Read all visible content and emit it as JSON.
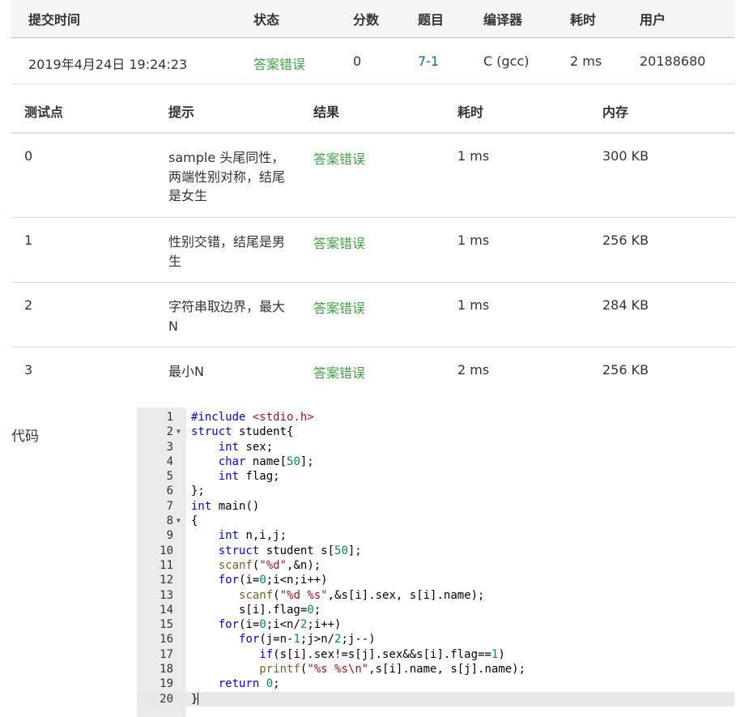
{
  "submission": {
    "headers": [
      "提交时间",
      "状态",
      "分数",
      "题目",
      "编译器",
      "耗时",
      "用户"
    ],
    "time": "2019年4月24日 19:24:23",
    "status": "答案错误",
    "score": "0",
    "problem": "7-1",
    "compiler": "C (gcc)",
    "elapsed": "2 ms",
    "user": "20188680"
  },
  "cases": {
    "headers": [
      "测试点",
      "提示",
      "结果",
      "耗时",
      "内存"
    ],
    "rows": [
      {
        "id": "0",
        "hint": "sample 头尾同性，两端性别对称，结尾是女生",
        "result": "答案错误",
        "time": "1 ms",
        "memory": "300 KB"
      },
      {
        "id": "1",
        "hint": "性别交错，结尾是男生",
        "result": "答案错误",
        "time": "1 ms",
        "memory": "256 KB"
      },
      {
        "id": "2",
        "hint": "字符串取边界，最大N",
        "result": "答案错误",
        "time": "1 ms",
        "memory": "284 KB"
      },
      {
        "id": "3",
        "hint": "最小N",
        "result": "答案错误",
        "time": "2 ms",
        "memory": "256 KB"
      }
    ]
  },
  "code": {
    "label": "代码",
    "lines": [
      "#include <stdio.h>",
      "struct student{",
      "    int sex;",
      "    char name[50];",
      "    int flag;",
      "};",
      "int main()",
      "{",
      "    int n,i,j;",
      "    struct student s[50];",
      "    scanf(\"%d\",&n);",
      "    for(i=0;i<n;i++)",
      "       scanf(\"%d %s\",&s[i].sex, s[i].name);",
      "       s[i].flag=0;",
      "    for(i=0;i<n/2;i++)",
      "       for(j=n-1;j>n/2;j--)",
      "          if(s[i].sex!=s[j].sex&&s[i].flag==1)",
      "          printf(\"%s %s\\n\",s[i].name, s[j].name);",
      "    return 0;",
      "}"
    ],
    "fold_lines": [
      2,
      8
    ],
    "active_line": 20
  },
  "colors": {
    "accepted_wrong": "#43a047",
    "link": "#1e5f9b"
  }
}
